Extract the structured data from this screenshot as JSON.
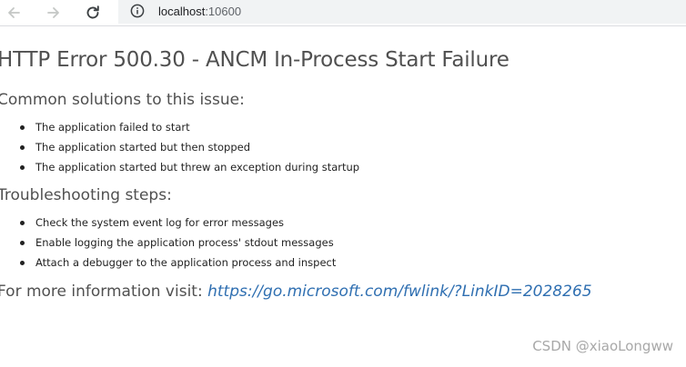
{
  "browser": {
    "url_host": "localhost",
    "url_port": ":10600",
    "icons": {
      "back": "back-arrow-icon",
      "forward": "forward-arrow-icon",
      "reload": "reload-icon",
      "info": "info-circle-icon"
    }
  },
  "page": {
    "title": "HTTP Error 500.30 - ANCM In-Process Start Failure",
    "solutions_heading": "Common solutions to this issue:",
    "solutions": [
      "The application failed to start",
      "The application started but then stopped",
      "The application started but threw an exception during startup"
    ],
    "troubleshooting_heading": "Troubleshooting steps:",
    "troubleshooting": [
      "Check the system event log for error messages",
      "Enable logging the application process' stdout messages",
      "Attach a debugger to the application process and inspect"
    ],
    "more_info_label": "For more information visit: ",
    "more_info_link": "https://go.microsoft.com/fwlink/?LinkID=2028265"
  },
  "watermark": "CSDN @xiaoLongww",
  "colors": {
    "link": "#2f6fb1",
    "heading": "#505050",
    "address_bar": "#f1f3f4"
  }
}
